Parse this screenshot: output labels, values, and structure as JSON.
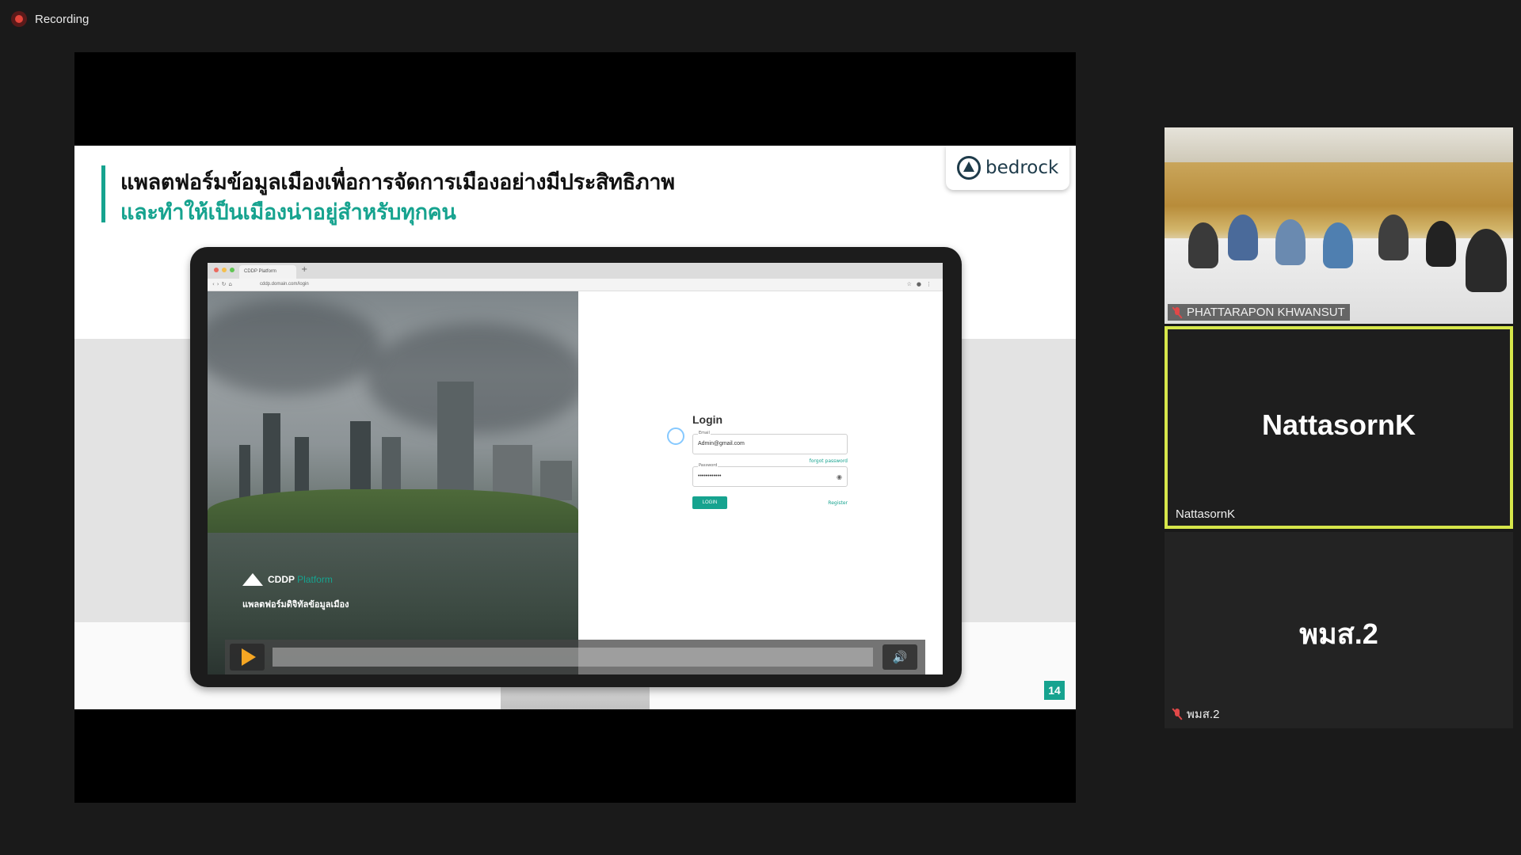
{
  "recording": {
    "label": "Recording"
  },
  "slide": {
    "title_line1": "แพลตฟอร์มข้อมูลเมืองเพื่อการจัดการเมืองอย่างมีประสิทธิภาพ",
    "title_line2": "และทำให้เป็นเมืองน่าอยู่สำหรับทุกคน",
    "brand": "bedrock",
    "page_number": "14",
    "accent_color": "#16a38f"
  },
  "mock_browser": {
    "tab_title": "CDDP Platform",
    "url": "cddp.domain.com/login",
    "platform_name": "CDDP",
    "platform_suffix": "Platform",
    "platform_thai": "แพลตฟอร์มดิจิทัลข้อมูลเมือง",
    "login": {
      "title": "Login",
      "email_label": "Email",
      "email_value": "Admin@gmail.com",
      "forgot_password": "forgot password",
      "password_label": "Password",
      "password_value": "••••••••••••",
      "login_button": "LOGIN",
      "register_link": "Register"
    }
  },
  "participants": [
    {
      "name": "PHATTARAPON KHWANSUT",
      "muted": true,
      "video": true
    },
    {
      "name": "NattasornK",
      "display": "NattasornK",
      "muted": false,
      "active_speaker": true
    },
    {
      "name": "พมส.2",
      "display": "พมส.2",
      "muted": true
    }
  ],
  "icons": {
    "rec": "record-icon",
    "mic": "mic-muted-icon",
    "play": "play-icon",
    "volume": "volume-icon"
  }
}
